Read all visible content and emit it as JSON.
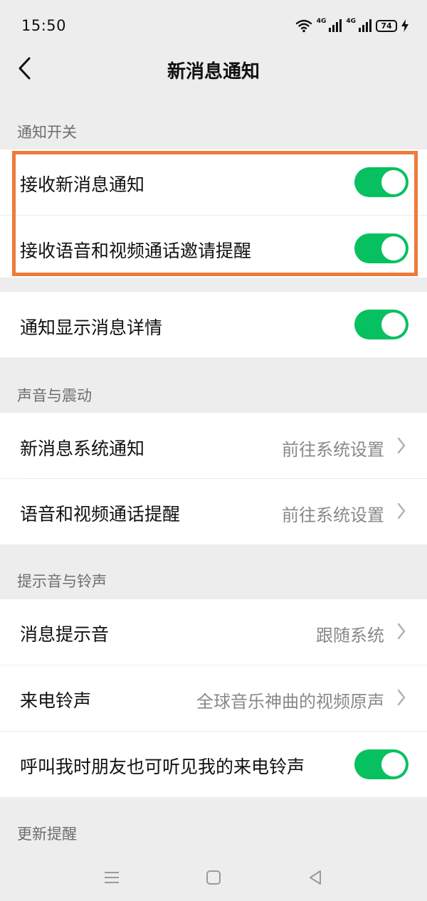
{
  "status_bar": {
    "time": "15:50",
    "network_1": "4G",
    "network_2": "4G",
    "battery": "74"
  },
  "header": {
    "title": "新消息通知"
  },
  "sections": {
    "notify_switch": {
      "title": "通知开关",
      "rows": [
        {
          "label": "接收新消息通知",
          "toggle": true
        },
        {
          "label": "接收语音和视频通话邀请提醒",
          "toggle": true
        }
      ]
    },
    "detail_row": {
      "label": "通知显示消息详情",
      "toggle": true
    },
    "sound_vibration": {
      "title": "声音与震动",
      "rows": [
        {
          "label": "新消息系统通知",
          "value": "前往系统设置"
        },
        {
          "label": "语音和视频通话提醒",
          "value": "前往系统设置"
        }
      ]
    },
    "tones": {
      "title": "提示音与铃声",
      "rows": [
        {
          "label": "消息提示音",
          "value": "跟随系统"
        },
        {
          "label": "来电铃声",
          "value": "全球音乐神曲的视频原声"
        },
        {
          "label": "呼叫我时朋友也可听见我的来电铃声",
          "toggle": true
        }
      ]
    },
    "update": {
      "title": "更新提醒"
    }
  },
  "colors": {
    "accent": "#07c160",
    "highlight": "#ee7b3a",
    "background": "#ededed"
  },
  "icons": {
    "back": "chevron-left-icon",
    "row_arrow": "chevron-right-icon",
    "nav_menu": "menu-icon",
    "nav_home": "home-square-icon",
    "nav_back": "back-triangle-icon"
  }
}
